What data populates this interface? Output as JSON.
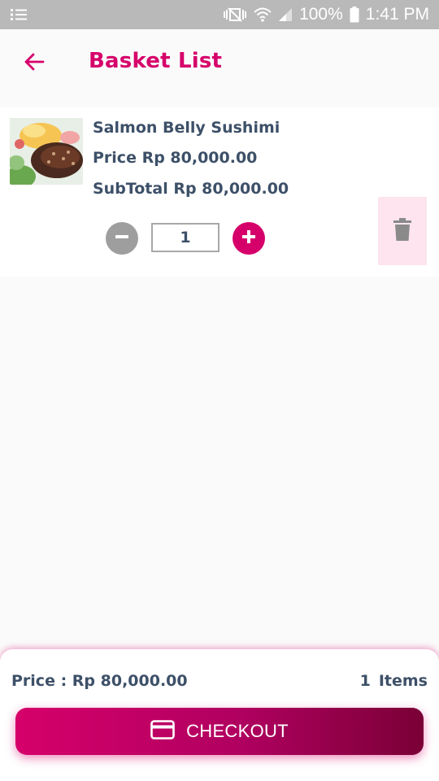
{
  "status_bar": {
    "battery_text": "100%",
    "time": "1:41 PM",
    "icons": [
      "notification-list-icon",
      "mute-vibrate-icon",
      "wifi-icon",
      "signal-icon",
      "battery-icon"
    ]
  },
  "app_bar": {
    "title": "Basket List",
    "back_icon": "arrow-left-icon"
  },
  "basket": {
    "items": [
      {
        "name": "Salmon Belly Sushimi",
        "price_label": "Price  Rp 80,000.00",
        "subtotal_label": "SubTotal Rp 80,000.00",
        "quantity": "1",
        "image_icon": "food-photo"
      }
    ]
  },
  "summary": {
    "price_label": "Price : Rp 80,000.00",
    "item_count": "1",
    "items_label": "Items"
  },
  "checkout": {
    "label": "CHECKOUT",
    "icon": "credit-card-icon"
  },
  "colors": {
    "accent": "#d6006a",
    "text": "#3d5068",
    "status_bar": "#b9b9b9",
    "delete_bg": "#fde4ee"
  }
}
